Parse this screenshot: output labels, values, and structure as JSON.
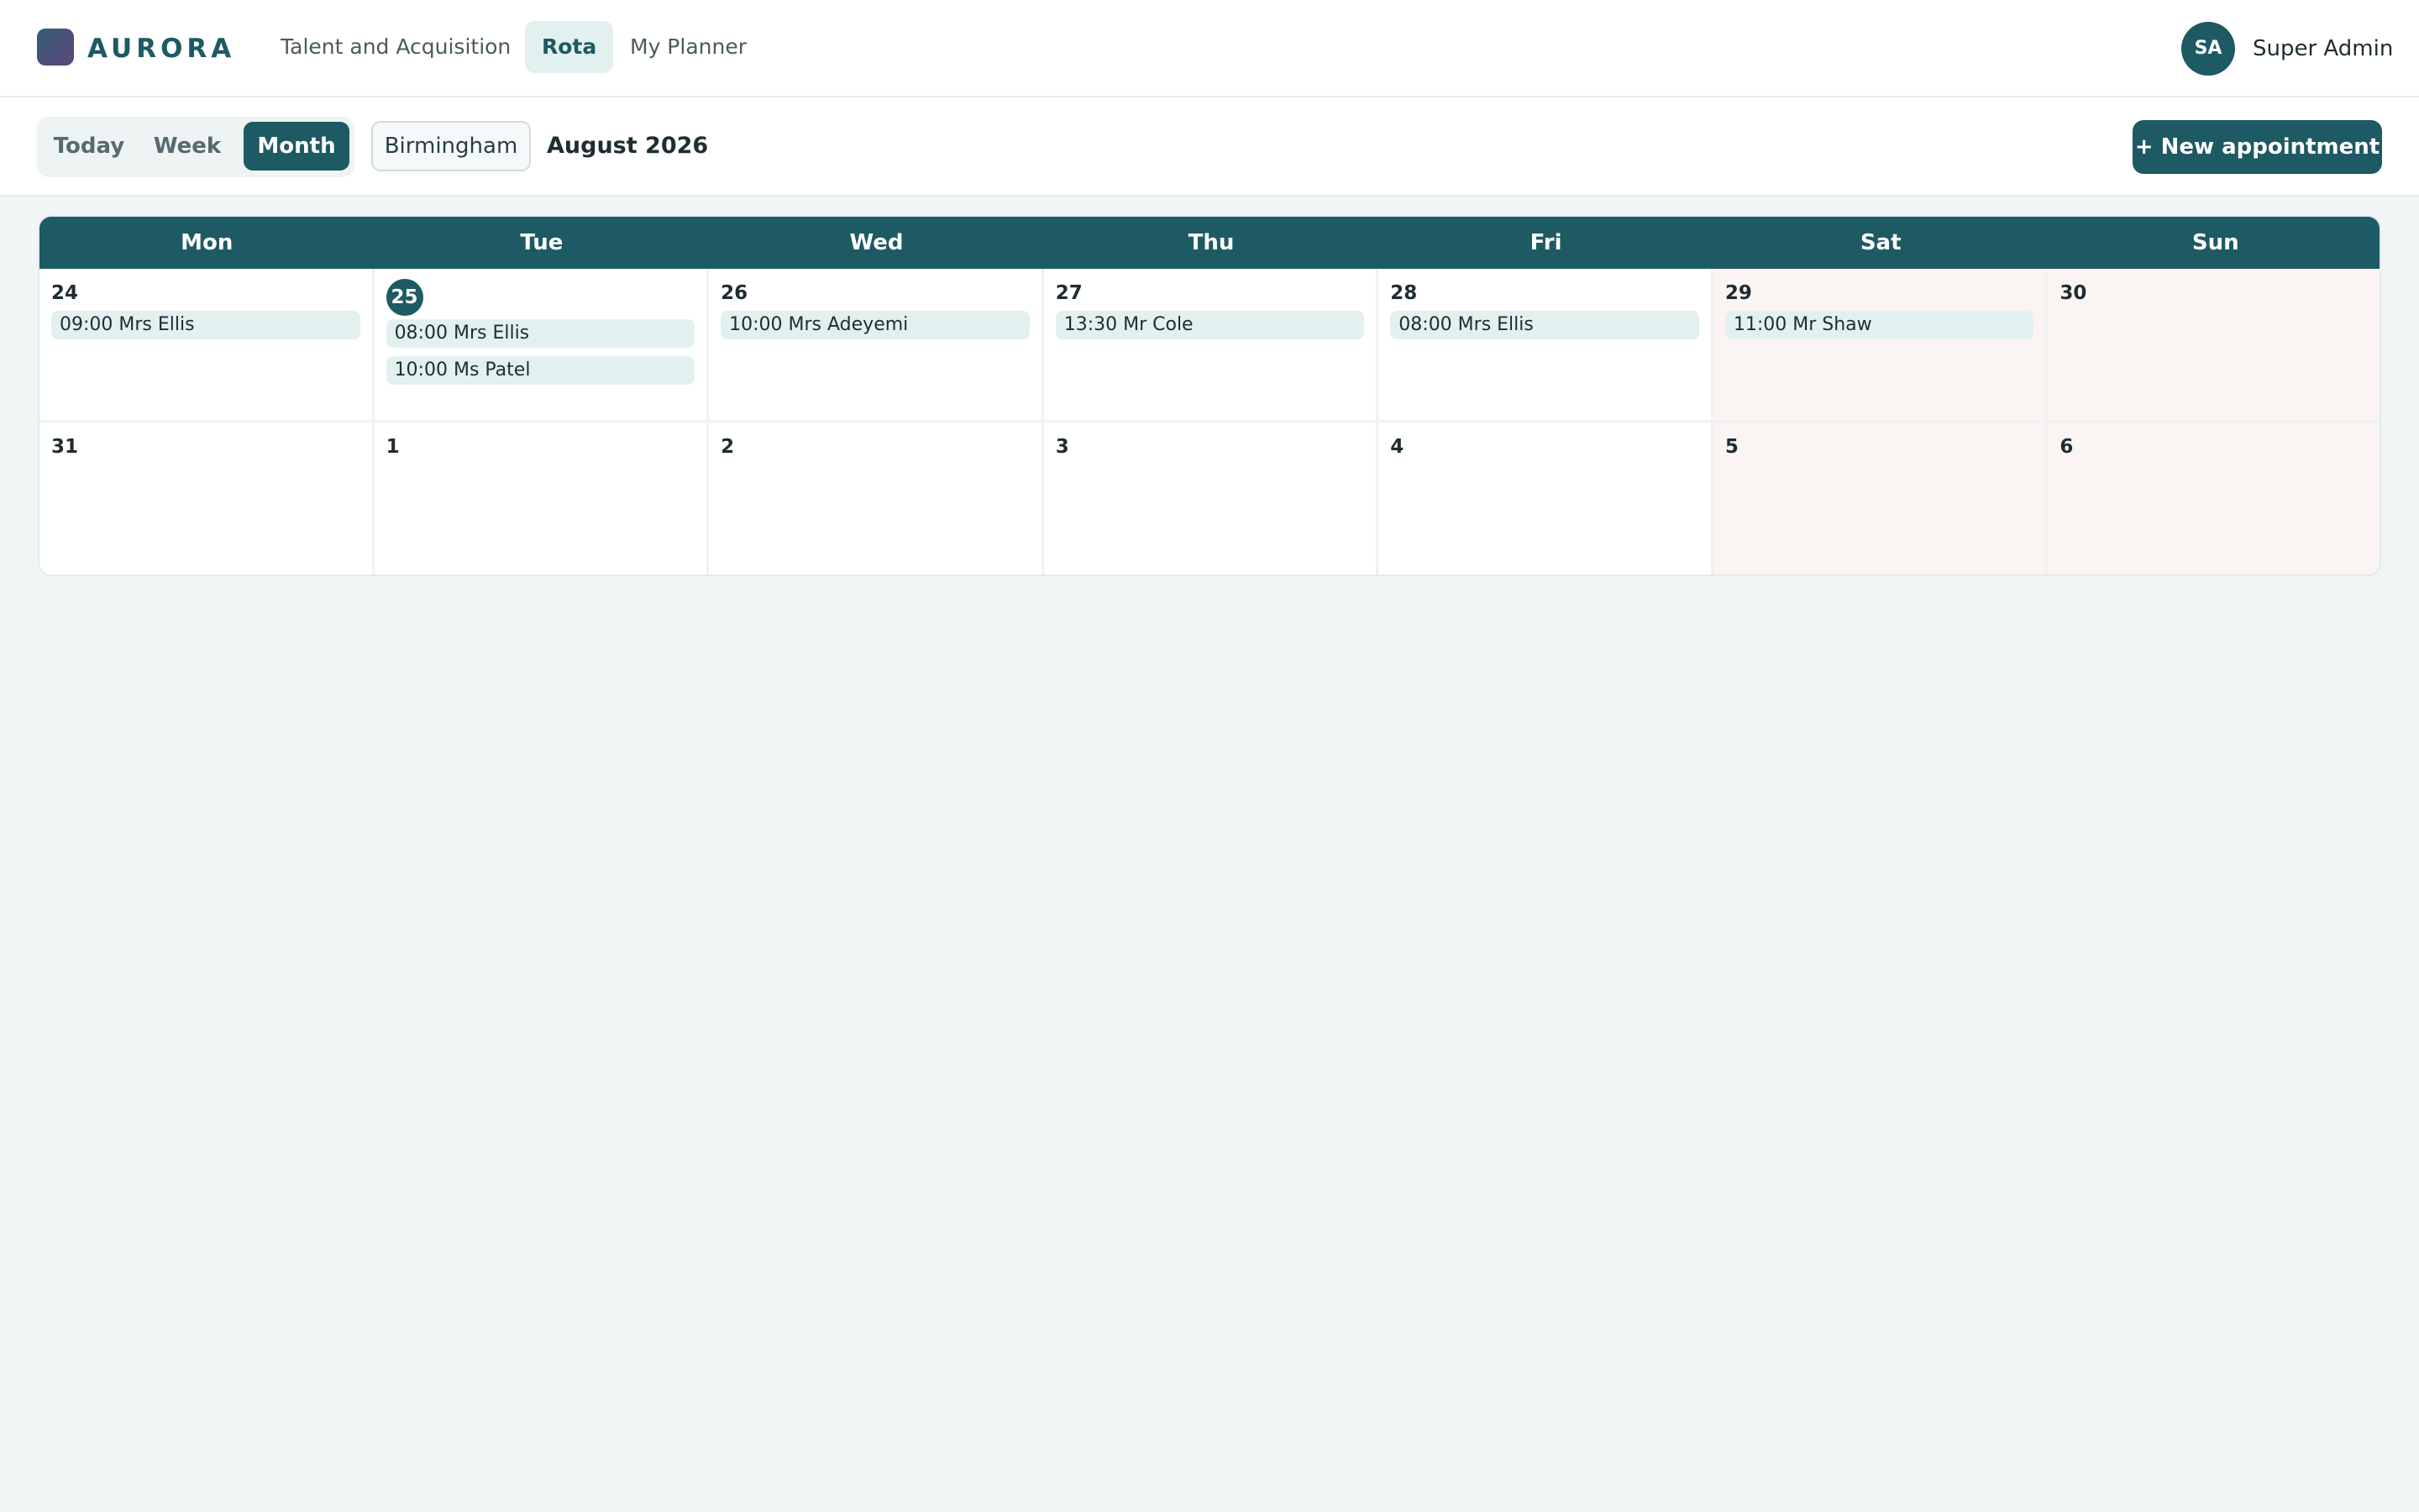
{
  "app": {
    "logo_text": "AURORA"
  },
  "nav": {
    "items": [
      {
        "label": "Talent and Acquisition",
        "active": false
      },
      {
        "label": "Rota",
        "active": true
      },
      {
        "label": "My Planner",
        "active": false
      }
    ]
  },
  "user": {
    "initials": "SA",
    "name": "Super Admin"
  },
  "toolbar": {
    "views": [
      {
        "label": "Today",
        "active": false
      },
      {
        "label": "Week",
        "active": false
      },
      {
        "label": "Month",
        "active": true
      }
    ],
    "location": "Birmingham",
    "period": "August 2026",
    "new_appointment_label": "+ New appointment"
  },
  "calendar": {
    "weekdays": [
      "Mon",
      "Tue",
      "Wed",
      "Thu",
      "Fri",
      "Sat",
      "Sun"
    ],
    "weeks": [
      [
        {
          "day": "24",
          "events": [
            "09:00 Mrs Ellis"
          ]
        },
        {
          "day": "25",
          "today": true,
          "events": [
            "08:00 Mrs Ellis",
            "10:00 Ms Patel"
          ]
        },
        {
          "day": "26",
          "events": [
            "10:00 Mrs Adeyemi"
          ]
        },
        {
          "day": "27",
          "events": [
            "13:30 Mr Cole"
          ]
        },
        {
          "day": "28",
          "events": [
            "08:00 Mrs Ellis"
          ]
        },
        {
          "day": "29",
          "weekend": true,
          "events": [
            "11:00 Mr Shaw"
          ]
        },
        {
          "day": "30",
          "weekend": true,
          "events": []
        }
      ],
      [
        {
          "day": "31",
          "events": []
        },
        {
          "day": "1",
          "events": []
        },
        {
          "day": "2",
          "events": []
        },
        {
          "day": "3",
          "events": []
        },
        {
          "day": "4",
          "events": []
        },
        {
          "day": "5",
          "weekend": true,
          "events": []
        },
        {
          "day": "6",
          "weekend": true,
          "events": []
        }
      ]
    ]
  }
}
